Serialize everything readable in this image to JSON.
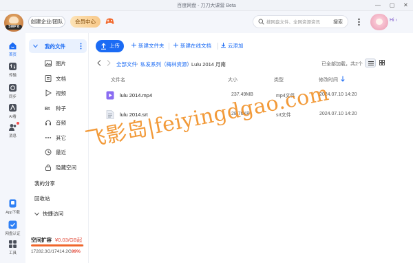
{
  "window": {
    "title": "百度网盘 - 刀刀大课营 Beta"
  },
  "header": {
    "logo_tag": "SWP 8",
    "enterprise_button": "创建企业/团队",
    "member_button": "会员中心",
    "search": {
      "placeholder": "搜网盘文件、全网资源资讯",
      "button": "搜索"
    },
    "greeting": "Hi",
    "greeting_arrow": "›"
  },
  "rail": {
    "items": [
      {
        "label": "首页",
        "icon": "home-icon"
      },
      {
        "label": "传输",
        "icon": "transfer-icon"
      },
      {
        "label": "同步",
        "icon": "sync-icon"
      },
      {
        "label": "AI看",
        "icon": "ai-icon"
      },
      {
        "label": "消息",
        "icon": "message-icon"
      }
    ],
    "bottom_items": [
      {
        "label": "App下载",
        "icon": "app-download-icon"
      },
      {
        "label": "网盘认证",
        "icon": "verify-icon"
      },
      {
        "label": "工具",
        "icon": "tools-icon"
      }
    ]
  },
  "sidebar": {
    "my_files": "我的文件",
    "categories": [
      {
        "label": "图片",
        "icon": "image-icon"
      },
      {
        "label": "文档",
        "icon": "document-icon"
      },
      {
        "label": "视频",
        "icon": "video-icon"
      },
      {
        "label": "种子",
        "icon": "torrent-icon"
      },
      {
        "label": "音频",
        "icon": "audio-icon"
      },
      {
        "label": "其它",
        "icon": "other-icon"
      },
      {
        "label": "最近",
        "icon": "recent-icon"
      },
      {
        "label": "隐藏空间",
        "icon": "hidden-space-icon"
      }
    ],
    "my_share": "我的分享",
    "recycle_bin": "回收站",
    "quick_access": "快捷访问",
    "storage": {
      "title": "空间扩容",
      "price": "¥0.03/GB起",
      "usage_text": "17282.3G/17414.2G",
      "usage_percent": "99%",
      "used_fraction": 0.99,
      "bar_color": "#f0662b"
    }
  },
  "toolbar": {
    "upload": "上传",
    "new_folder": "新建文件夹",
    "new_doc": "新建在线文档",
    "cloud_add": "云添加"
  },
  "breadcrumb": {
    "items": [
      "全部文件",
      "私发系列（梅林资源）",
      "Lulu 2014 月南"
    ],
    "separator": "›",
    "loaded_text": "已全部加载，共2个"
  },
  "table": {
    "columns": [
      "文件名",
      "大小",
      "类型",
      "修改时间"
    ],
    "rows": [
      {
        "name": "lulu 2014.mp4",
        "size": "237.49MB",
        "type": "mp4文件",
        "date": "2024.07.10 14:20",
        "icon": "video-file-icon"
      },
      {
        "name": "lulu 2014.srt",
        "size": "28.76KB",
        "type": "srt文件",
        "date": "2024.07.10 14:20",
        "icon": "text-file-icon"
      }
    ]
  },
  "watermark": "飞影岛|feiyingdgao.com",
  "colors": {
    "accent": "#1b6bf4",
    "rail_bg": "#f4f6fb",
    "sidebar_active_bg": "#e9f1fe",
    "watermark": "#f08c1e",
    "price": "#e24b3b"
  }
}
